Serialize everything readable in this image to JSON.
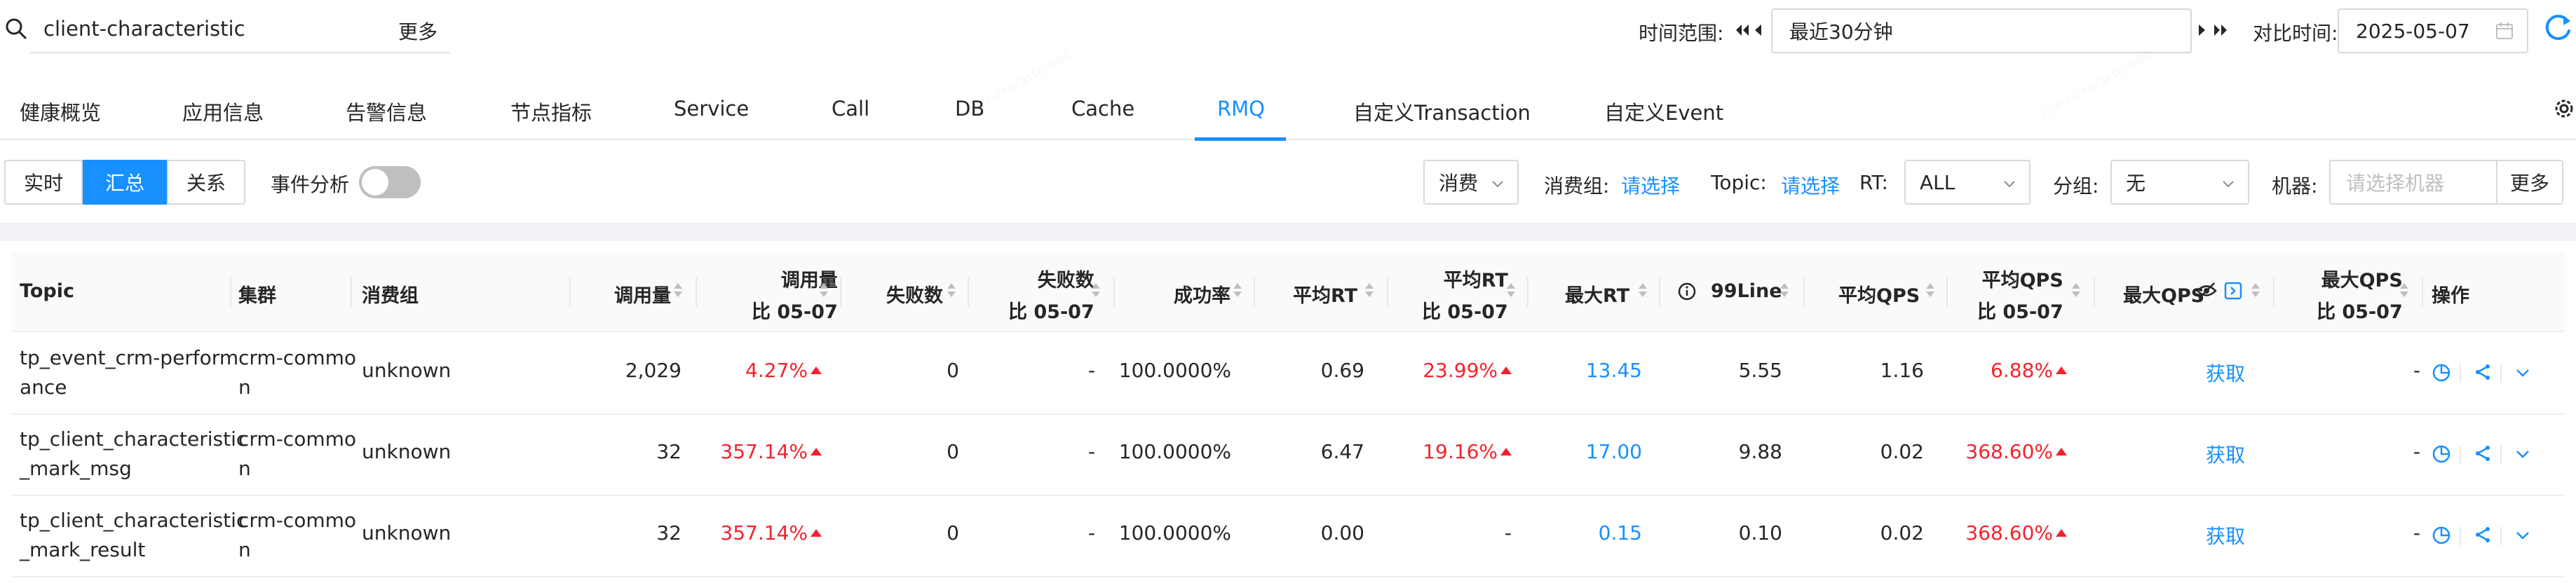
{
  "search": {
    "value": "client-characteristic",
    "more_label": "更多"
  },
  "time": {
    "range_label": "时间范围:",
    "range_value": "最近30分钟",
    "compare_label": "对比时间:",
    "compare_value": "2025-05-07"
  },
  "tabs": [
    {
      "label": "健康概览"
    },
    {
      "label": "应用信息"
    },
    {
      "label": "告警信息"
    },
    {
      "label": "节点指标"
    },
    {
      "label": "Service"
    },
    {
      "label": "Call"
    },
    {
      "label": "DB"
    },
    {
      "label": "Cache"
    },
    {
      "label": "RMQ",
      "active": true
    },
    {
      "label": "自定义Transaction"
    },
    {
      "label": "自定义Event"
    }
  ],
  "filters": {
    "view_segments": [
      "实时",
      "汇总",
      "关系"
    ],
    "active_segment": "汇总",
    "event_analysis_label": "事件分析",
    "event_analysis_on": false,
    "mode_select": "消费",
    "consumer_group_label": "消费组:",
    "consumer_group_link": "请选择",
    "topic_label": "Topic:",
    "topic_link": "请选择",
    "rt_label": "RT:",
    "rt_value": "ALL",
    "group_label": "分组:",
    "group_value": "无",
    "machine_label": "机器:",
    "machine_placeholder": "请选择机器",
    "more_label": "更多"
  },
  "table": {
    "headers": {
      "topic": "Topic",
      "cluster": "集群",
      "consumer_group": "消费组",
      "calls": "调用量",
      "calls_cmp_1": "调用量",
      "calls_cmp_2": "比 05-07",
      "failures": "失败数",
      "failures_cmp_1": "失败数",
      "failures_cmp_2": "比 05-07",
      "success_rate": "成功率",
      "avg_rt": "平均RT",
      "avg_rt_cmp_1": "平均RT",
      "avg_rt_cmp_2": "比 05-07",
      "max_rt": "最大RT",
      "line99": "99Line",
      "avg_qps": "平均QPS",
      "avg_qps_cmp_1": "平均QPS",
      "avg_qps_cmp_2": "比 05-07",
      "max_qps": "最大QPS",
      "max_qps_cmp_1": "最大QPS",
      "max_qps_cmp_2": "比 05-07",
      "actions": "操作"
    },
    "rows": [
      {
        "topic_1": "tp_event_crm-perform",
        "topic_2": "ance",
        "cluster_1": "crm-commo",
        "cluster_2": "n",
        "consumer_group": "unknown",
        "calls": "2,029",
        "calls_cmp": "4.27%",
        "failures": "0",
        "failures_cmp": "-",
        "success_rate": "100.0000%",
        "avg_rt": "0.69",
        "avg_rt_cmp": "23.99%",
        "max_rt": "13.45",
        "line99": "5.55",
        "avg_qps": "1.16",
        "avg_qps_cmp": "6.88%",
        "max_qps": "获取",
        "max_qps_cmp": "-"
      },
      {
        "topic_1": "tp_client_characteristic",
        "topic_2": "_mark_msg",
        "cluster_1": "crm-commo",
        "cluster_2": "n",
        "consumer_group": "unknown",
        "calls": "32",
        "calls_cmp": "357.14%",
        "failures": "0",
        "failures_cmp": "-",
        "success_rate": "100.0000%",
        "avg_rt": "6.47",
        "avg_rt_cmp": "19.16%",
        "max_rt": "17.00",
        "line99": "9.88",
        "avg_qps": "0.02",
        "avg_qps_cmp": "368.60%",
        "max_qps": "获取",
        "max_qps_cmp": "-"
      },
      {
        "topic_1": "tp_client_characteristic",
        "topic_2": "_mark_result",
        "cluster_1": "crm-commo",
        "cluster_2": "n",
        "consumer_group": "unknown",
        "calls": "32",
        "calls_cmp": "357.14%",
        "failures": "0",
        "failures_cmp": "-",
        "success_rate": "100.0000%",
        "avg_rt": "0.00",
        "avg_rt_cmp": "-",
        "max_rt": "0.15",
        "line99": "0.10",
        "avg_qps": "0.02",
        "avg_qps_cmp": "368.60%",
        "max_qps": "获取",
        "max_qps_cmp": "-"
      }
    ]
  },
  "colors": {
    "accent": "#1890ff",
    "increase": "#f5222d",
    "border": "#d9d9d9"
  }
}
